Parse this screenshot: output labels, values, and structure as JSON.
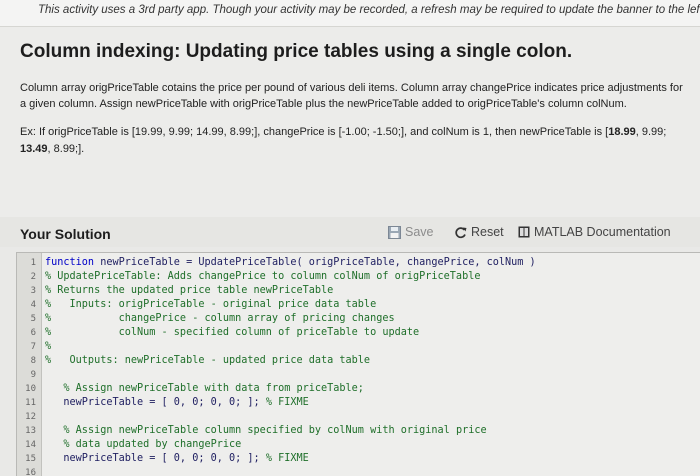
{
  "banner": {
    "text": "This activity uses a 3rd party app. Though your activity may be recorded, a refresh may be required to update the banner to the left."
  },
  "problem": {
    "title": "Column indexing: Updating price tables using a single colon.",
    "description": "Column array origPriceTable cotains the price per pound of various deli items. Column array changePrice indicates price adjustments for a given column. Assign newPriceTable with origPriceTable plus the newPriceTable added to origPriceTable's column colNum.",
    "example_prefix": "Ex: If origPriceTable is [19.99, 9.99; 14.99, 8.99;], changePrice is [-1.00; -1.50;], and colNum is 1, then newPriceTable is [",
    "example_b1": "18.99",
    "example_mid1": ", 9.99; ",
    "example_b2": "13.49",
    "example_suffix": ", 8.99;]."
  },
  "solution": {
    "title": "Your Solution",
    "save_label": "Save",
    "reset_label": "Reset",
    "doc_label": "MATLAB Documentation",
    "icons": {
      "save": "save-icon",
      "reset": "reset-icon",
      "doc": "matlab-doc-icon"
    }
  },
  "editor": {
    "lines": [
      {
        "num": "1",
        "kw": "function",
        "text": " newPriceTable = UpdatePriceTable( origPriceTable, changePrice, colNum )",
        "comment": ""
      },
      {
        "num": "2",
        "kw": "",
        "text": "",
        "comment": "% UpdatePriceTable: Adds changePrice to column colNum of origPriceTable"
      },
      {
        "num": "3",
        "kw": "",
        "text": "",
        "comment": "% Returns the updated price table newPriceTable"
      },
      {
        "num": "4",
        "kw": "",
        "text": "",
        "comment": "%   Inputs: origPriceTable - original price data table"
      },
      {
        "num": "5",
        "kw": "",
        "text": "",
        "comment": "%           changePrice - column array of pricing changes"
      },
      {
        "num": "6",
        "kw": "",
        "text": "",
        "comment": "%           colNum - specified column of priceTable to update"
      },
      {
        "num": "7",
        "kw": "",
        "text": "",
        "comment": "%"
      },
      {
        "num": "8",
        "kw": "",
        "text": "",
        "comment": "%   Outputs: newPriceTable - updated price data table"
      },
      {
        "num": "9",
        "kw": "",
        "text": "",
        "comment": ""
      },
      {
        "num": "10",
        "kw": "",
        "text": "   ",
        "comment": "% Assign newPriceTable with data from priceTable;"
      },
      {
        "num": "11",
        "kw": "",
        "text": "   newPriceTable = [ 0, 0; 0, 0; ]; ",
        "comment": "% FIXME"
      },
      {
        "num": "12",
        "kw": "",
        "text": "",
        "comment": ""
      },
      {
        "num": "13",
        "kw": "",
        "text": "   ",
        "comment": "% Assign newPriceTable column specified by colNum with original price"
      },
      {
        "num": "14",
        "kw": "",
        "text": "   ",
        "comment": "% data updated by changePrice"
      },
      {
        "num": "15",
        "kw": "",
        "text": "   newPriceTable = [ 0, 0; 0, 0; ]; ",
        "comment": "% FIXME"
      },
      {
        "num": "16",
        "kw": "",
        "text": "",
        "comment": ""
      }
    ]
  }
}
